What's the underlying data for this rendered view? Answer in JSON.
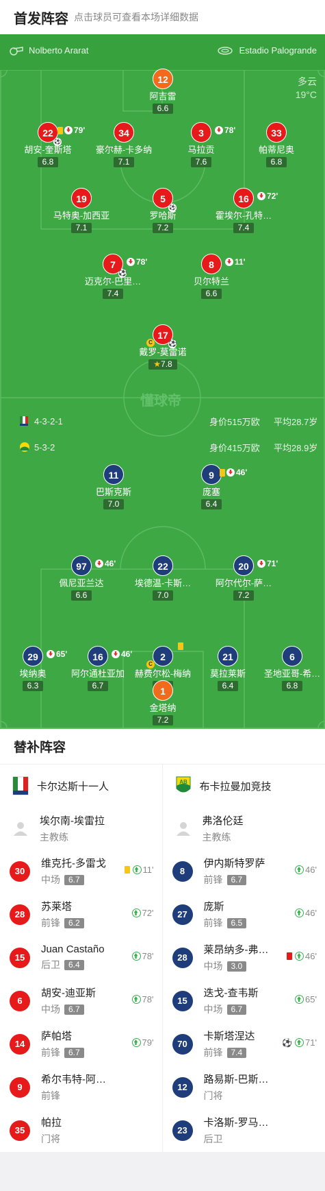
{
  "header": {
    "title": "首发阵容",
    "subtitle": "点击球员可查看本场详细数据"
  },
  "match_info": {
    "referee": "Nolberto Ararat",
    "stadium": "Estadio Palogrande",
    "weather": "多云",
    "temperature": "19°C"
  },
  "home": {
    "formation": "4-3-2-1",
    "value": "身价515万欧",
    "avg_age": "平均28.7岁",
    "players": [
      {
        "num": "12",
        "name": "阿吉雷",
        "rating": "6.6"
      },
      {
        "num": "22",
        "name": "胡安-奎斯塔",
        "rating": "6.8",
        "minute": "79'"
      },
      {
        "num": "34",
        "name": "豪尔赫-卡多纳",
        "rating": "7.1"
      },
      {
        "num": "3",
        "name": "马拉贡",
        "rating": "7.6",
        "minute": "78'"
      },
      {
        "num": "33",
        "name": "帕蒂尼奥",
        "rating": "6.8"
      },
      {
        "num": "19",
        "name": "马特奥-加西亚",
        "rating": "7.1"
      },
      {
        "num": "5",
        "name": "罗哈斯",
        "rating": "7.2"
      },
      {
        "num": "16",
        "name": "霍埃尔-孔特…",
        "rating": "7.4",
        "minute": "72'"
      },
      {
        "num": "7",
        "name": "迈克尔-巴里…",
        "rating": "7.4",
        "minute": "78'"
      },
      {
        "num": "8",
        "name": "贝尔特兰",
        "rating": "6.6",
        "minute": "11'"
      },
      {
        "num": "17",
        "name": "戴罗-莫雷诺",
        "rating": "7.8",
        "cap": "C"
      }
    ]
  },
  "away": {
    "formation": "5-3-2",
    "value": "身价415万欧",
    "avg_age": "平均28.9岁",
    "players": [
      {
        "num": "11",
        "name": "巴斯克斯",
        "rating": "7.0"
      },
      {
        "num": "9",
        "name": "庞塞",
        "rating": "6.4",
        "minute": "46'"
      },
      {
        "num": "97",
        "name": "佩尼亚兰达",
        "rating": "6.6",
        "minute": "46'"
      },
      {
        "num": "22",
        "name": "埃德温-卡斯…",
        "rating": "7.0"
      },
      {
        "num": "20",
        "name": "阿尔代尔-萨…",
        "rating": "7.2",
        "minute": "71'"
      },
      {
        "num": "29",
        "name": "埃纳奥",
        "rating": "6.3",
        "minute": "65'"
      },
      {
        "num": "16",
        "name": "阿尔通杜亚加",
        "rating": "6.7",
        "minute": "46'"
      },
      {
        "num": "2",
        "name": "赫费尔松-梅纳",
        "rating": "6.4",
        "cap": "C"
      },
      {
        "num": "21",
        "name": "莫拉莱斯",
        "rating": "6.4"
      },
      {
        "num": "6",
        "name": "圣地亚哥-希…",
        "rating": "6.8"
      },
      {
        "num": "1",
        "name": "金塔纳",
        "rating": "7.2"
      }
    ]
  },
  "watermark": "懂球帝",
  "subs": {
    "title": "替补阵容",
    "home": {
      "team": "卡尔达斯十一人",
      "coach": {
        "name": "埃尔南-埃雷拉",
        "role": "主教练"
      },
      "list": [
        {
          "num": "30",
          "name": "维克托-多雷戈",
          "pos": "中场",
          "rating": "6.7",
          "minute": "11'"
        },
        {
          "num": "28",
          "name": "苏莱塔",
          "pos": "前锋",
          "rating": "6.2",
          "minute": "72'"
        },
        {
          "num": "15",
          "name": "Juan Castaño",
          "pos": "后卫",
          "rating": "6.4",
          "minute": "78'"
        },
        {
          "num": "6",
          "name": "胡安-迪亚斯",
          "pos": "中场",
          "rating": "6.7",
          "minute": "78'"
        },
        {
          "num": "14",
          "name": "萨帕塔",
          "pos": "前锋",
          "rating": "6.7",
          "minute": "79'"
        },
        {
          "num": "9",
          "name": "希尔韦特-阿…",
          "pos": "前锋"
        },
        {
          "num": "35",
          "name": "帕拉",
          "pos": "门将"
        }
      ]
    },
    "away": {
      "team": "布卡拉曼加竞技",
      "coach": {
        "name": "弗洛伦廷",
        "role": "主教练"
      },
      "list": [
        {
          "num": "8",
          "name": "伊内斯特罗萨",
          "pos": "前锋",
          "rating": "6.7",
          "minute": "46'"
        },
        {
          "num": "27",
          "name": "庞斯",
          "pos": "前锋",
          "rating": "6.5",
          "minute": "46'"
        },
        {
          "num": "28",
          "name": "莱昂纳多-弗…",
          "pos": "中场",
          "rating": "3.0",
          "minute": "46'"
        },
        {
          "num": "15",
          "name": "迭戈-查韦斯",
          "pos": "中场",
          "rating": "6.7",
          "minute": "65'"
        },
        {
          "num": "70",
          "name": "卡斯塔涅达",
          "pos": "前锋",
          "rating": "7.4",
          "minute": "71'"
        },
        {
          "num": "12",
          "name": "路易斯-巴斯…",
          "pos": "门将"
        },
        {
          "num": "23",
          "name": "卡洛斯-罗马…",
          "pos": "后卫"
        }
      ]
    }
  }
}
